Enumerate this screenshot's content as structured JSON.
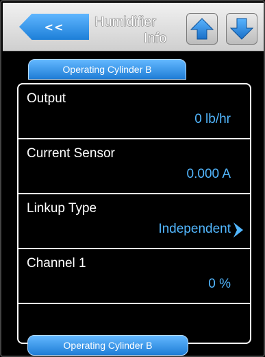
{
  "header": {
    "back_label": "<<",
    "title_line1": "Humidifier",
    "title_line2": "Info"
  },
  "icons": {
    "up": "arrow-up-icon",
    "down": "arrow-down-icon",
    "chevron": "chevron-right-icon"
  },
  "tabs": {
    "top_label": "Operating Cylinder B",
    "bottom_label": "Operating Cylinder B"
  },
  "rows": [
    {
      "label": "Output",
      "value": "0 lb/hr"
    },
    {
      "label": "Current Sensor",
      "value": "0.000 A"
    },
    {
      "label": "Linkup Type",
      "value": "Independent"
    },
    {
      "label": "Channel 1",
      "value": "0 %"
    }
  ],
  "colors": {
    "accent_blue": "#1f7dd6",
    "value_blue": "#52b7ff",
    "header_bg": "#e0e0e0"
  }
}
